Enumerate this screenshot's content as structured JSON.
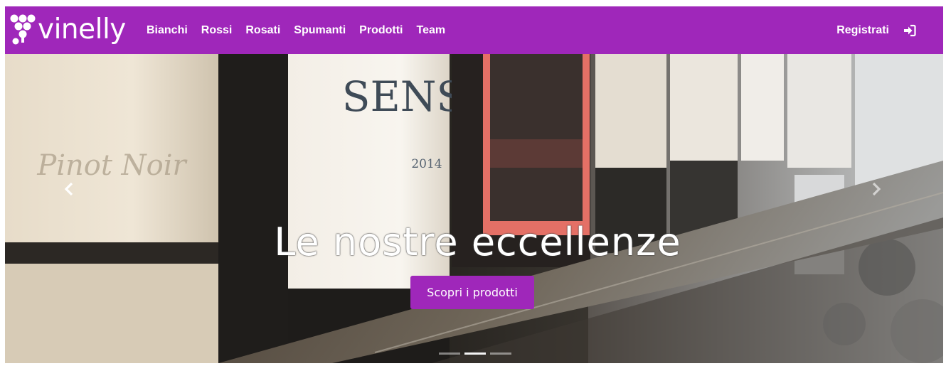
{
  "brand": {
    "name": "vinelly"
  },
  "nav": {
    "links": [
      "Bianchi",
      "Rossi",
      "Rosati",
      "Spumanti",
      "Prodotti",
      "Team"
    ],
    "register_label": "Registrati"
  },
  "icons": {
    "logo": "grapes-icon",
    "login": "sign-in-icon",
    "prev": "chevron-left-icon",
    "next": "chevron-right-icon"
  },
  "carousel": {
    "caption_title": "Le nostre eccellenze",
    "cta_label": "Scopri i prodotti",
    "slide_count": 3,
    "active_slide": 2
  },
  "label_text": {
    "brand": "SENS",
    "year": "2014"
  },
  "colors": {
    "accent": "#9f27ba",
    "text_on_accent": "#ffffff"
  }
}
